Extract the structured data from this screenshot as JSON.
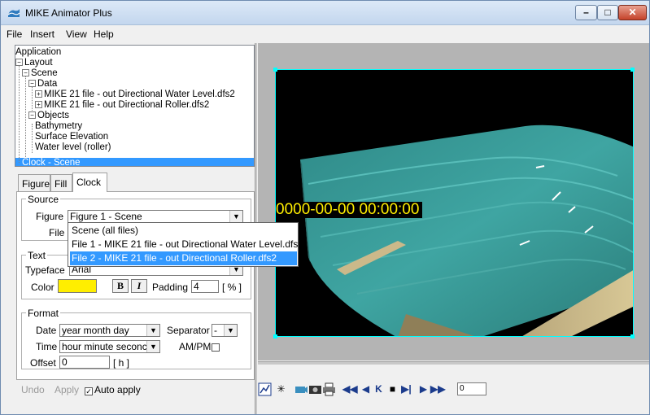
{
  "window": {
    "title": "MIKE Animator Plus",
    "controls": {
      "minimize": "–",
      "maximize": "□",
      "close": "✕"
    }
  },
  "menu": [
    "File",
    "Insert",
    "View",
    "Help"
  ],
  "tree": {
    "nodes": [
      {
        "label": "Application",
        "toggle": ""
      },
      {
        "label": "Layout",
        "toggle": "−"
      },
      {
        "label": "Scene",
        "toggle": "−"
      },
      {
        "label": "Data",
        "toggle": "−"
      },
      {
        "label": "MIKE 21 file - out Directional Water Level.dfs2",
        "toggle": "+"
      },
      {
        "label": "MIKE 21 file - out Directional Roller.dfs2",
        "toggle": "+"
      },
      {
        "label": "Objects",
        "toggle": "−"
      },
      {
        "label": "Bathymetry",
        "toggle": ""
      },
      {
        "label": "Surface Elevation",
        "toggle": ""
      },
      {
        "label": "Water level (roller)",
        "toggle": ""
      },
      {
        "label": "Clock - Scene",
        "toggle": "",
        "selected": true
      }
    ]
  },
  "tabs": [
    "Figure",
    "Fill",
    "Clock"
  ],
  "active_tab": "Clock",
  "source": {
    "legend": "Source",
    "figure_label": "Figure",
    "figure_value": "Figure 1 - Scene",
    "file_label": "File",
    "dropdown_options": [
      "Scene (all files)",
      "File 1 - MIKE 21 file - out Directional Water Level.dfs2",
      "File 2 - MIKE 21 file - out Directional Roller.dfs2"
    ],
    "selected_option_index": 2
  },
  "text_group": {
    "legend": "Text",
    "typeface_label": "Typeface",
    "typeface_value": "Arial",
    "color_label": "Color",
    "color_value": "#ffee00",
    "bold_label": "B",
    "italic_label": "I",
    "padding_label": "Padding",
    "padding_value": "4",
    "padding_unit": "[ % ]"
  },
  "format_group": {
    "legend": "Format",
    "date_label": "Date",
    "date_value": "year month day",
    "separator_label": "Separator",
    "separator_value": "-",
    "time_label": "Time",
    "time_value": "hour minute seconc",
    "ampm_label": "AM/PM",
    "offset_label": "Offset",
    "offset_value": "0",
    "offset_unit": "[ h ]"
  },
  "actions": {
    "undo": "Undo",
    "apply": "Apply",
    "auto_apply": "Auto apply",
    "auto_apply_checked": true
  },
  "viewport": {
    "clock_text": "0000-00-00 00:00:00",
    "clock_color": "#ffee00"
  },
  "player": {
    "tools": [
      "chart-icon",
      "asterisk-icon",
      "camera-icon",
      "photo-icon",
      "print-icon"
    ],
    "controls": [
      "first",
      "prev-fast",
      "prev",
      "stop",
      "play",
      "next",
      "last"
    ],
    "frame_value": "0"
  }
}
